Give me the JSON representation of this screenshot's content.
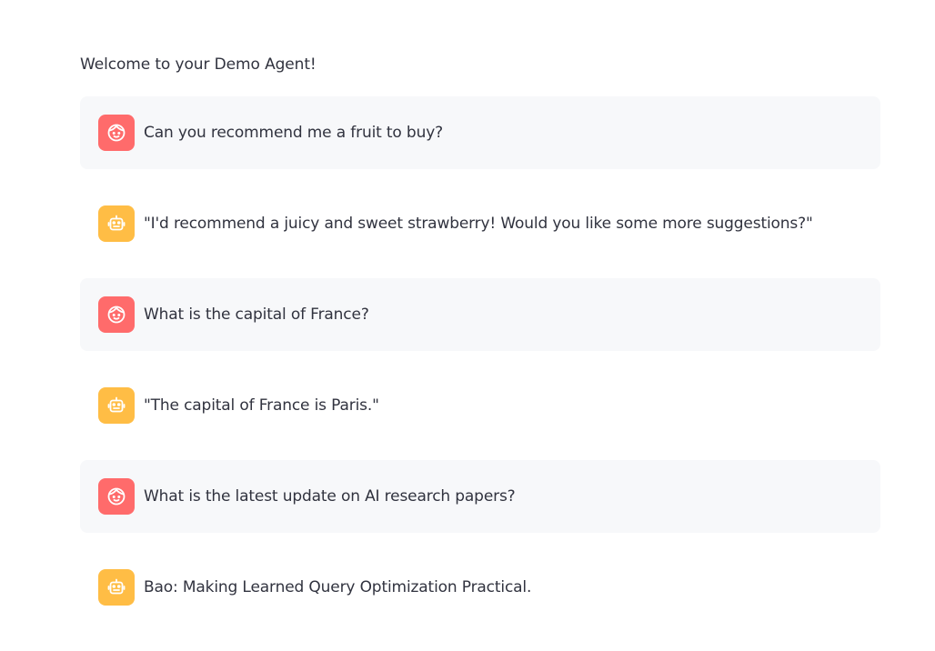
{
  "welcome_text": "Welcome to your Demo Agent!",
  "colors": {
    "user_avatar": "#ff6b6b",
    "assistant_avatar": "#ffbd45",
    "user_bubble": "#f7f8fa",
    "text": "#31333f"
  },
  "messages": [
    {
      "role": "user",
      "icon": "user-face-icon",
      "text": "Can you recommend me a fruit to buy?"
    },
    {
      "role": "assistant",
      "icon": "robot-icon",
      "text": "\"I'd recommend a juicy and sweet strawberry! Would you like some more suggestions?\""
    },
    {
      "role": "user",
      "icon": "user-face-icon",
      "text": "What is the capital of France?"
    },
    {
      "role": "assistant",
      "icon": "robot-icon",
      "text": "\"The capital of France is Paris.\""
    },
    {
      "role": "user",
      "icon": "user-face-icon",
      "text": "What is the latest update on AI research papers?"
    },
    {
      "role": "assistant",
      "icon": "robot-icon",
      "text": "Bao: Making Learned Query Optimization Practical."
    }
  ]
}
